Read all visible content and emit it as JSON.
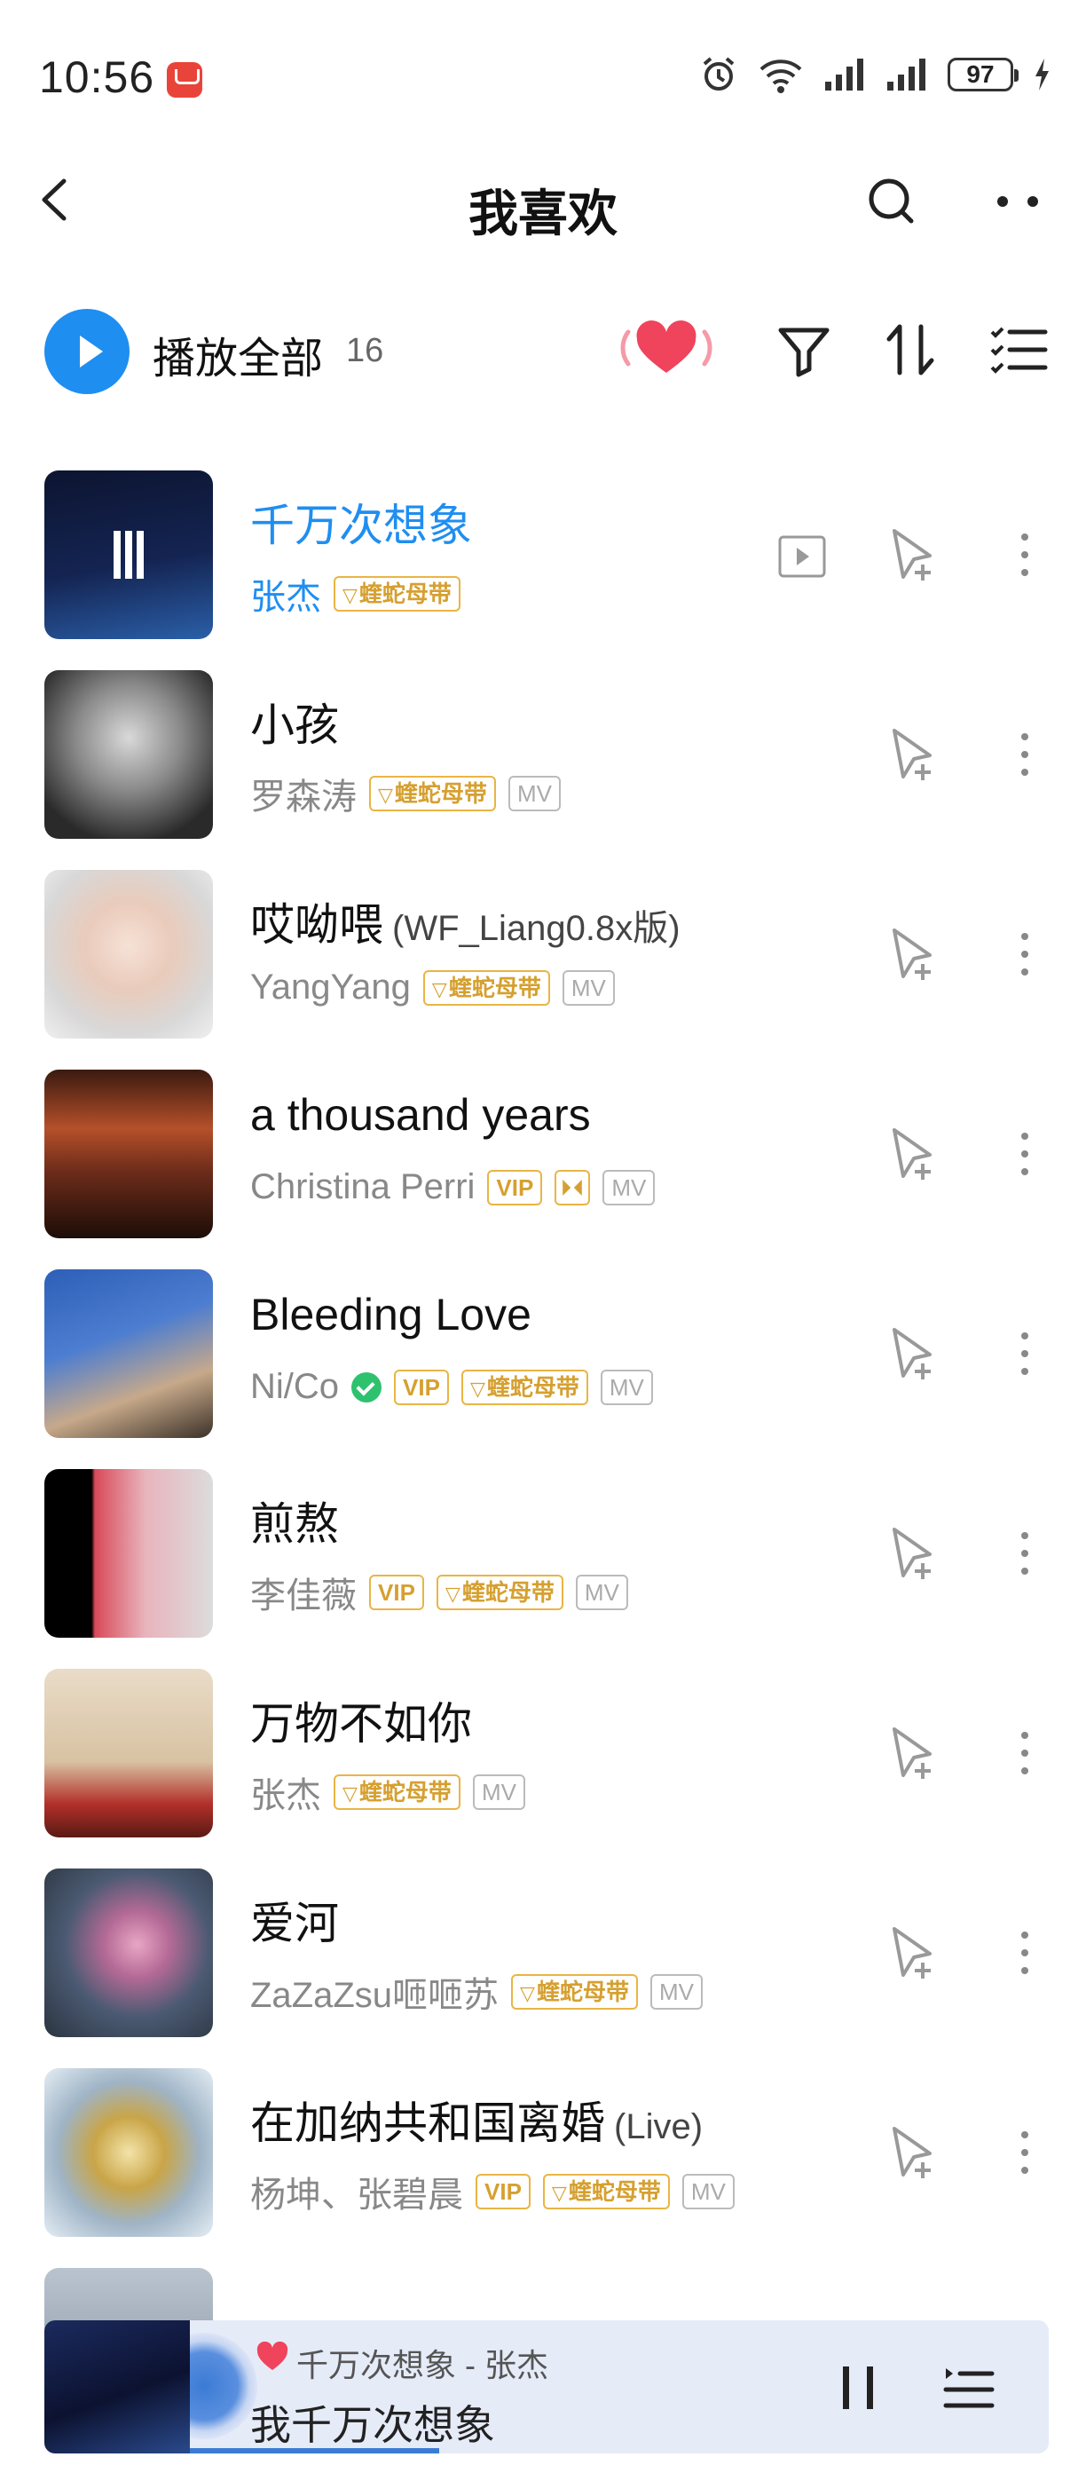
{
  "status_bar": {
    "time": "10:56",
    "battery": "97",
    "icons": [
      "huawei-app-icon",
      "alarm-icon",
      "wifi-6-icon",
      "signal-icon",
      "signal-icon",
      "battery-icon",
      "charging-icon"
    ]
  },
  "header": {
    "title": "我喜欢",
    "icons": [
      "back-arrow-icon",
      "search-icon",
      "more-dots-icon"
    ]
  },
  "toolbar": {
    "play_all_label": "播放全部",
    "count": "16",
    "icons": [
      "play-icon",
      "heart-pulse-icon",
      "filter-icon",
      "sort-icon",
      "multi-select-icon"
    ]
  },
  "songs": [
    {
      "title": "千万次想象",
      "suffix": "",
      "artist": "张杰",
      "tags": [
        "蝰蛇母带"
      ],
      "playing": true
    },
    {
      "title": "小孩",
      "suffix": "",
      "artist": "罗森涛",
      "tags": [
        "蝰蛇母带",
        "MV"
      ]
    },
    {
      "title": "哎呦喂",
      "suffix": "(WF_Liang0.8x版)",
      "artist": "YangYang",
      "tags": [
        "蝰蛇母带",
        "MV"
      ]
    },
    {
      "title": "a thousand years",
      "suffix": "",
      "artist": "Christina Perri",
      "tags": [
        "VIP",
        "MV"
      ]
    },
    {
      "title": "Bleeding Love",
      "suffix": "",
      "artist": "Ni/Co",
      "tags": [
        "VIP",
        "蝰蛇母带",
        "MV"
      ]
    },
    {
      "title": "煎熬",
      "suffix": "",
      "artist": "李佳薇",
      "tags": [
        "VIP",
        "蝰蛇母带",
        "MV"
      ]
    },
    {
      "title": "万物不如你",
      "suffix": "",
      "artist": "张杰",
      "tags": [
        "蝰蛇母带",
        "MV"
      ]
    },
    {
      "title": "爱河",
      "suffix": "",
      "artist": "ZaZaZsu咂咂苏",
      "tags": [
        "蝰蛇母带",
        "MV"
      ]
    },
    {
      "title": "在加纳共和国离婚",
      "suffix": "(Live)",
      "artist": "杨坤、张碧晨",
      "tags": [
        "VIP",
        "蝰蛇母带",
        "MV"
      ]
    }
  ],
  "mini_player": {
    "song_line": "千万次想象  -  张杰",
    "lyric": "我千万次想象",
    "progress": 0.29,
    "icons": [
      "heart-icon",
      "pause-icon",
      "playlist-icon"
    ]
  },
  "colors": {
    "accent": "#1f8ef1",
    "gold_tag": "#d6a030",
    "heart": "#f0435c",
    "mini_player_bg": "#e6ebf8"
  }
}
